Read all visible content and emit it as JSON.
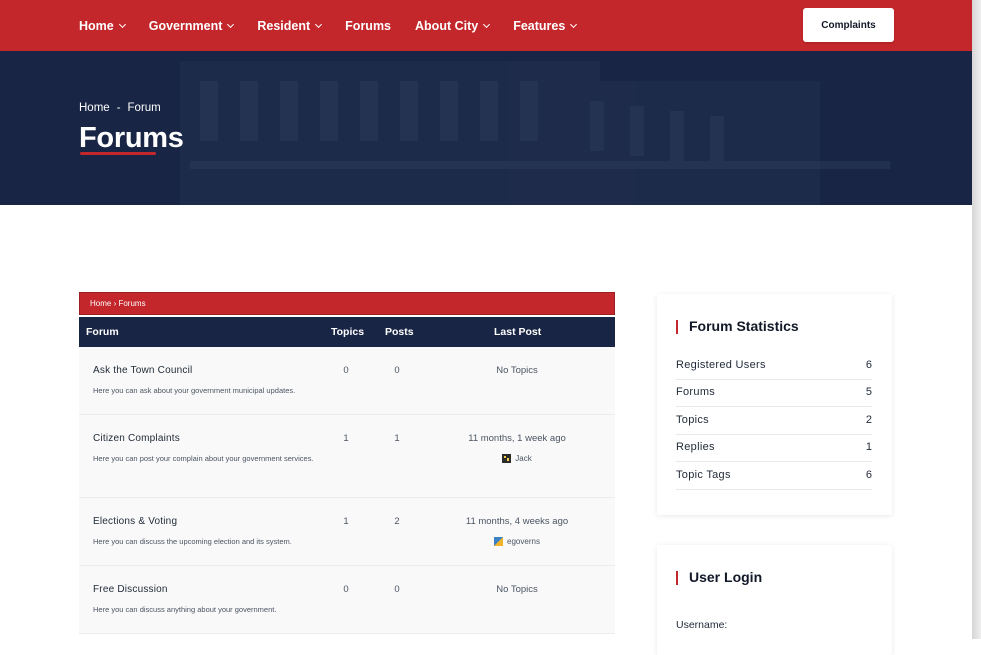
{
  "nav": {
    "items": [
      {
        "label": "Home",
        "dropdown": true
      },
      {
        "label": "Government",
        "dropdown": true
      },
      {
        "label": "Resident",
        "dropdown": true
      },
      {
        "label": "Forums",
        "dropdown": false
      },
      {
        "label": "About City",
        "dropdown": true
      },
      {
        "label": "Features",
        "dropdown": true
      }
    ],
    "cta_label": "Complaints"
  },
  "hero": {
    "breadcrumb": {
      "home": "Home",
      "sep": "-",
      "current": "Forum"
    },
    "title": "Forums"
  },
  "forum_table": {
    "breadcrumb": "Home › Forums",
    "headers": {
      "forum": "Forum",
      "topics": "Topics",
      "posts": "Posts",
      "last_post": "Last Post"
    },
    "rows": [
      {
        "title": "Ask the Town Council",
        "description": "Here you can ask about your government municipal updates.",
        "topics": "0",
        "posts": "0",
        "last_post": "No Topics",
        "user": ""
      },
      {
        "title": "Citizen Complaints",
        "description": "Here you can post your complain about your government services.",
        "topics": "1",
        "posts": "1",
        "last_post": "11 months, 1 week ago",
        "user": "Jack"
      },
      {
        "title": "Elections & Voting",
        "description": "Here you can discuss the upcoming election and its system.",
        "topics": "1",
        "posts": "2",
        "last_post": "11 months, 4 weeks ago",
        "user": "egoverns"
      },
      {
        "title": "Free Discussion",
        "description": "Here you can discuss anything about your government.",
        "topics": "0",
        "posts": "0",
        "last_post": "No Topics",
        "user": ""
      }
    ]
  },
  "stats_widget": {
    "title": "Forum Statistics",
    "rows": [
      {
        "label": "Registered Users",
        "value": "6"
      },
      {
        "label": "Forums",
        "value": "5"
      },
      {
        "label": "Topics",
        "value": "2"
      },
      {
        "label": "Replies",
        "value": "1"
      },
      {
        "label": "Topic Tags",
        "value": "6"
      }
    ]
  },
  "login_widget": {
    "title": "User Login",
    "username_label": "Username:"
  },
  "colors": {
    "brand_red": "#c3272b",
    "navy": "#182544"
  }
}
